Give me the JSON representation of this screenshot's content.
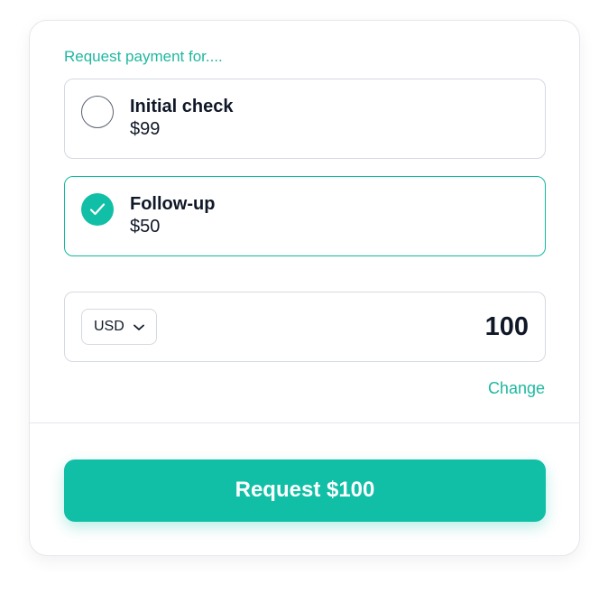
{
  "form": {
    "section_title": "Request payment for....",
    "options": [
      {
        "title": "Initial check",
        "price": "$99",
        "selected": false
      },
      {
        "title": "Follow-up",
        "price": "$50",
        "selected": true
      }
    ],
    "currency": "USD",
    "amount": "100",
    "change_label": "Change",
    "submit_label": "Request $100"
  },
  "colors": {
    "accent": "#10bfa6",
    "text": "#101828",
    "border": "#d5d9e0"
  },
  "icons": {
    "radio_checked": "checkmark-icon",
    "currency_dropdown": "chevron-down-icon"
  }
}
